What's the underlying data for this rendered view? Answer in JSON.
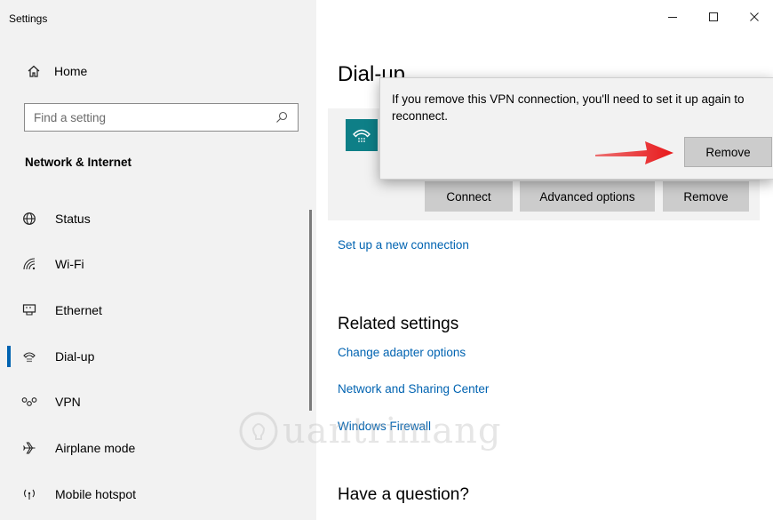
{
  "window": {
    "title": "Settings"
  },
  "sidebar": {
    "home_label": "Home",
    "search_placeholder": "Find a setting",
    "section_title": "Network & Internet",
    "items": [
      {
        "label": "Status",
        "icon": "globe-icon"
      },
      {
        "label": "Wi-Fi",
        "icon": "wifi-icon"
      },
      {
        "label": "Ethernet",
        "icon": "ethernet-icon"
      },
      {
        "label": "Dial-up",
        "icon": "dial-up-icon",
        "active": true
      },
      {
        "label": "VPN",
        "icon": "vpn-icon"
      },
      {
        "label": "Airplane mode",
        "icon": "airplane-icon"
      },
      {
        "label": "Mobile hotspot",
        "icon": "hotspot-icon"
      }
    ]
  },
  "main": {
    "title": "Dial-up",
    "connection_buttons": {
      "connect": "Connect",
      "advanced": "Advanced options",
      "remove": "Remove"
    },
    "setup_link": "Set up a new connection",
    "related_heading": "Related settings",
    "related_links": [
      "Change adapter options",
      "Network and Sharing Center",
      "Windows Firewall"
    ],
    "question_heading": "Have a question?"
  },
  "flyout": {
    "message": "If you remove this VPN connection, you'll need to set it up again to reconnect.",
    "remove_label": "Remove"
  },
  "watermark": {
    "text": "uantrimang"
  },
  "colors": {
    "accent": "#0063b1",
    "vpn_tile": "#0e7f87",
    "arrow": "#e8191b",
    "sidebar_bg": "#f2f2f2",
    "button_bg": "#cccccc"
  }
}
